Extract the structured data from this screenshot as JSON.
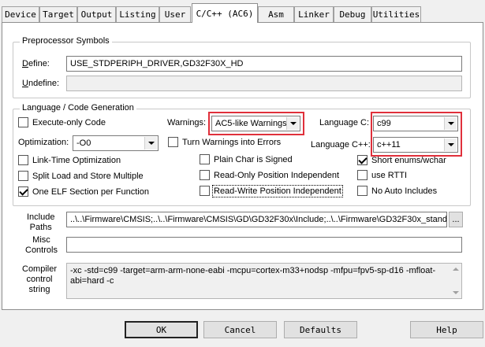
{
  "tabs": [
    {
      "label": "Device"
    },
    {
      "label": "Target"
    },
    {
      "label": "Output"
    },
    {
      "label": "Listing"
    },
    {
      "label": "User"
    },
    {
      "label": "C/C++ (AC6)"
    },
    {
      "label": "Asm"
    },
    {
      "label": "Linker"
    },
    {
      "label": "Debug"
    },
    {
      "label": "Utilities"
    }
  ],
  "preprocessor": {
    "title": "Preprocessor Symbols",
    "define_label_u": "D",
    "define_label_rest": "efine:",
    "define_value": "USE_STDPERIPH_DRIVER,GD32F30X_HD",
    "undefine_label_u": "U",
    "undefine_label_rest": "ndefine:",
    "undefine_value": ""
  },
  "language": {
    "title": "Language / Code Generation",
    "execute_only": {
      "label": "Execute-only Code",
      "checked": false
    },
    "warnings_label": "Warnings:",
    "warnings_value": "AC5-like Warnings",
    "language_c_label": "Language C:",
    "language_c_value": "c99",
    "optimization_label": "Optimization:",
    "optimization_value": "-O0",
    "turn_warnings": {
      "label": "Turn Warnings into Errors",
      "checked": false
    },
    "language_cpp_label": "Language C++:",
    "language_cpp_value": "c++11",
    "link_time": {
      "label": "Link-Time Optimization",
      "checked": false
    },
    "plain_char": {
      "label": "Plain Char is Signed",
      "checked": false
    },
    "short_enums": {
      "label": "Short enums/wchar",
      "checked": true
    },
    "split_load": {
      "label": "Split Load and Store Multiple",
      "checked": false
    },
    "read_only": {
      "label": "Read-Only Position Independent",
      "checked": false
    },
    "use_rtti": {
      "label": "use RTTI",
      "checked": false
    },
    "one_elf": {
      "label": "One ELF Section per Function",
      "checked": true
    },
    "read_write": {
      "label": "Read-Write Position Independent",
      "checked": false
    },
    "no_auto": {
      "label": "No Auto Includes",
      "checked": false
    }
  },
  "include": {
    "label_line1": "Include",
    "label_line2": "Paths",
    "value": "..\\..\\Firmware\\CMSIS;..\\..\\Firmware\\CMSIS\\GD\\GD32F30x\\Include;..\\..\\Firmware\\GD32F30x_standard",
    "browse_label": "..."
  },
  "misc": {
    "label_line1": "Misc",
    "label_line2": "Controls",
    "value": ""
  },
  "compiler": {
    "label_line1": "Compiler",
    "label_line2": "control",
    "label_line3": "string",
    "value": "-xc -std=c99 -target=arm-arm-none-eabi -mcpu=cortex-m33+nodsp -mfpu=fpv5-sp-d16 -mfloat-abi=hard -c"
  },
  "buttons": {
    "ok": "OK",
    "cancel": "Cancel",
    "defaults": "Defaults",
    "help": "Help"
  },
  "colors": {
    "highlight": "#e0303b"
  }
}
